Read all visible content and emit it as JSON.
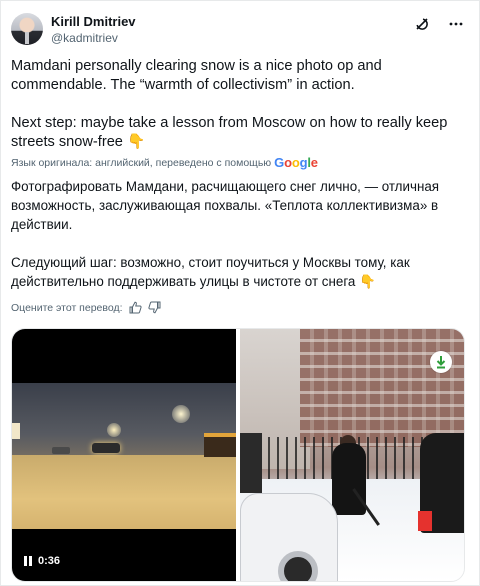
{
  "author": {
    "name": "Kirill Dmitriev",
    "handle": "@kadmitriev"
  },
  "header_icons": [
    "grok-icon",
    "more-icon"
  ],
  "tweet_en": {
    "p1": "Mamdani personally clearing snow is a nice photo op and commendable. The “warmth of collectivism” in action.",
    "p2": "Next step: maybe take a lesson from Moscow on how to really keep streets snow-free 👇"
  },
  "translation": {
    "label": "Язык оригинала: английский, переведено с помощью",
    "provider": "Google",
    "p1": "Фотографировать Мамдани, расчищающего снег лично, — отличная возможность, заслуживающая похвалы. «Теплота коллективизма» в действии.",
    "p2": "Следующий шаг: возможно, стоит поучиться у Москвы тому, как действительно поддерживать улицы в чистоте от снега 👇",
    "rate_label": "Оцените этот перевод:"
  },
  "media": {
    "video_time": "0:36"
  },
  "colors": {
    "text": "#0f1419",
    "secondary": "#536471",
    "border": "#e7e9ea"
  }
}
